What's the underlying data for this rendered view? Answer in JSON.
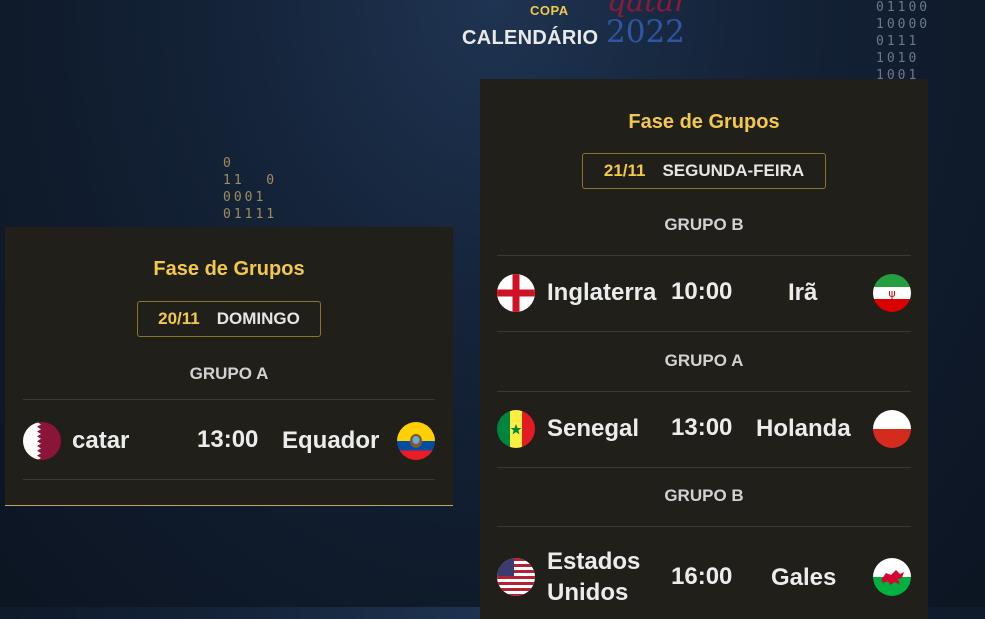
{
  "header": {
    "copa": "COPA",
    "calendario": "CALENDÁRIO",
    "qatar_word": "qatar",
    "year": "2022"
  },
  "binary_left": [
    "0",
    "11  0",
    "0001",
    "01111"
  ],
  "binary_right": [
    "01100",
    "10000",
    "0111",
    "1010",
    "1001"
  ],
  "cards": [
    {
      "phase": "Fase de Grupos",
      "date": "20/11",
      "weekday": "DOMINGO",
      "matches": [
        {
          "group": "GRUPO A",
          "home": "catar",
          "time": "13:00",
          "away": "Equador",
          "home_flag": "qatar-flag-icon",
          "away_flag": "ecuador-flag-icon"
        }
      ]
    },
    {
      "phase": "Fase de Grupos",
      "date": "21/11",
      "weekday": "SEGUNDA-FEIRA",
      "matches": [
        {
          "group": "GRUPO B",
          "home": "Inglaterra",
          "time": "10:00",
          "away": "Irã",
          "home_flag": "england-flag-icon",
          "away_flag": "iran-flag-icon"
        },
        {
          "group": "GRUPO A",
          "home": "Senegal",
          "time": "13:00",
          "away": "Holanda",
          "home_flag": "senegal-flag-icon",
          "away_flag": "netherlands-flag-icon"
        },
        {
          "group": "GRUPO B",
          "home": "Estados Unidos",
          "time": "16:00",
          "away": "Gales",
          "home_flag": "usa-flag-icon",
          "away_flag": "wales-flag-icon"
        }
      ]
    }
  ],
  "colors": {
    "accent": "#f2c94c",
    "card_bg": "#201f1a",
    "page_bg": "#15243a"
  }
}
